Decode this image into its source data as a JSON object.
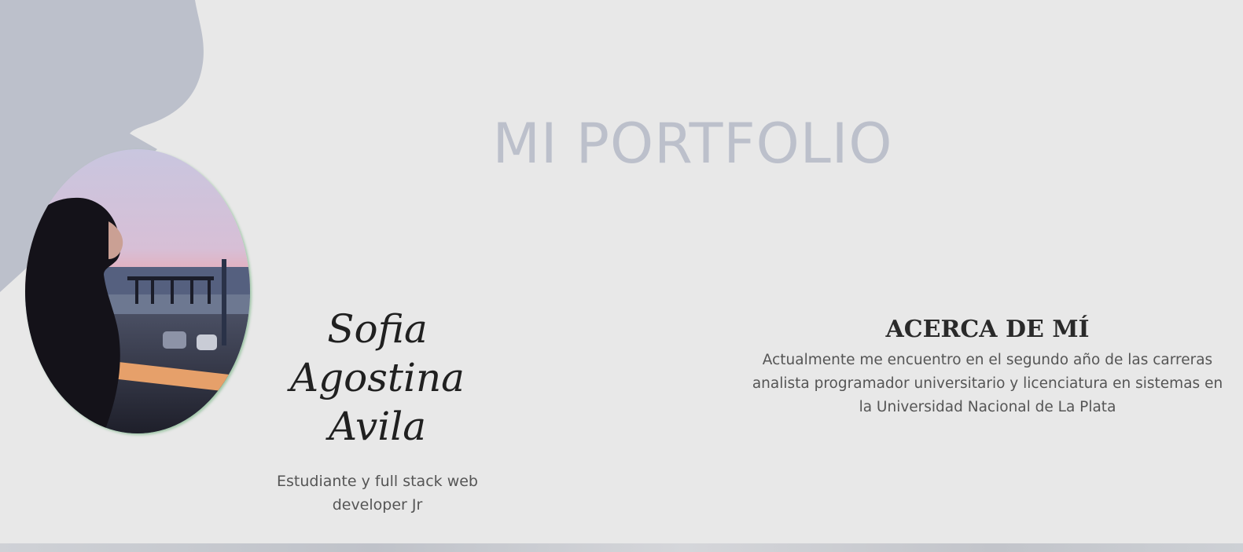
{
  "colors": {
    "background": "#e8e8e8",
    "blob": "#bcc0cb",
    "title": "#bcc0cb",
    "heading": "#2a2a2a",
    "body_text": "#555555",
    "photo_shadow": "#8cbe96"
  },
  "hero": {
    "title": "MI PORTFOLIO"
  },
  "profile": {
    "photo_icon": "profile-photo",
    "name_lines": [
      "Sofia",
      "Agostina",
      "Avila"
    ],
    "role": "Estudiante y full stack web developer Jr"
  },
  "about": {
    "title": "ACERCA DE MÍ",
    "text": "Actualmente me encuentro en el segundo año de las carreras analista programador universitario y licenciatura en sistemas en la Universidad Nacional de La Plata"
  }
}
